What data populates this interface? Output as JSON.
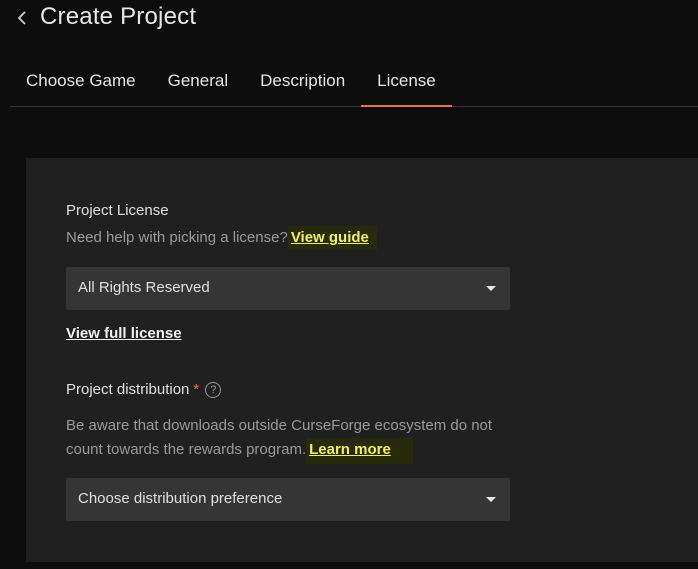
{
  "header": {
    "title": "Create Project",
    "back_icon": "chevron-left-icon"
  },
  "tabs": [
    {
      "label": "Choose Game"
    },
    {
      "label": "General"
    },
    {
      "label": "Description"
    },
    {
      "label": "License",
      "active": true
    }
  ],
  "license": {
    "label": "Project License",
    "help_text": "Need help with picking a license?",
    "guide_link": "View guide",
    "selected": "All Rights Reserved",
    "full_license_link": "View full license"
  },
  "distribution": {
    "label": "Project distribution",
    "required_mark": "*",
    "help_icon": "?",
    "help_text_line1": "Be aware that downloads outside CurseForge ecosystem do not",
    "help_text_line2": "count towards the rewards program.",
    "learn_more_link": "Learn more",
    "selected": "Choose distribution preference"
  },
  "colors": {
    "accent": "#e8704f",
    "highlight": "#f0f060",
    "panel": "#202020"
  }
}
